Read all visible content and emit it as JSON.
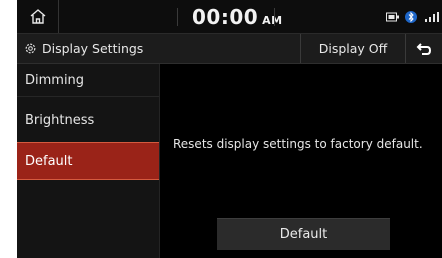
{
  "status": {
    "time": "00:00",
    "ampm": "AM",
    "icons": [
      "home-icon",
      "display-icon",
      "bluetooth-icon",
      "signal-icon"
    ]
  },
  "header": {
    "title": "Display Settings",
    "display_off_label": "Display Off",
    "icons": [
      "gear-icon",
      "back-arrow-icon"
    ]
  },
  "sidebar": {
    "items": [
      {
        "label": "Dimming",
        "selected": false
      },
      {
        "label": "Brightness",
        "selected": false
      },
      {
        "label": "Default",
        "selected": true
      }
    ]
  },
  "main": {
    "description": "Resets display settings to factory default.",
    "default_button_label": "Default"
  },
  "colors": {
    "selected_bg": "#9a2318",
    "selected_border": "#d55a3f",
    "background": "#000000"
  }
}
